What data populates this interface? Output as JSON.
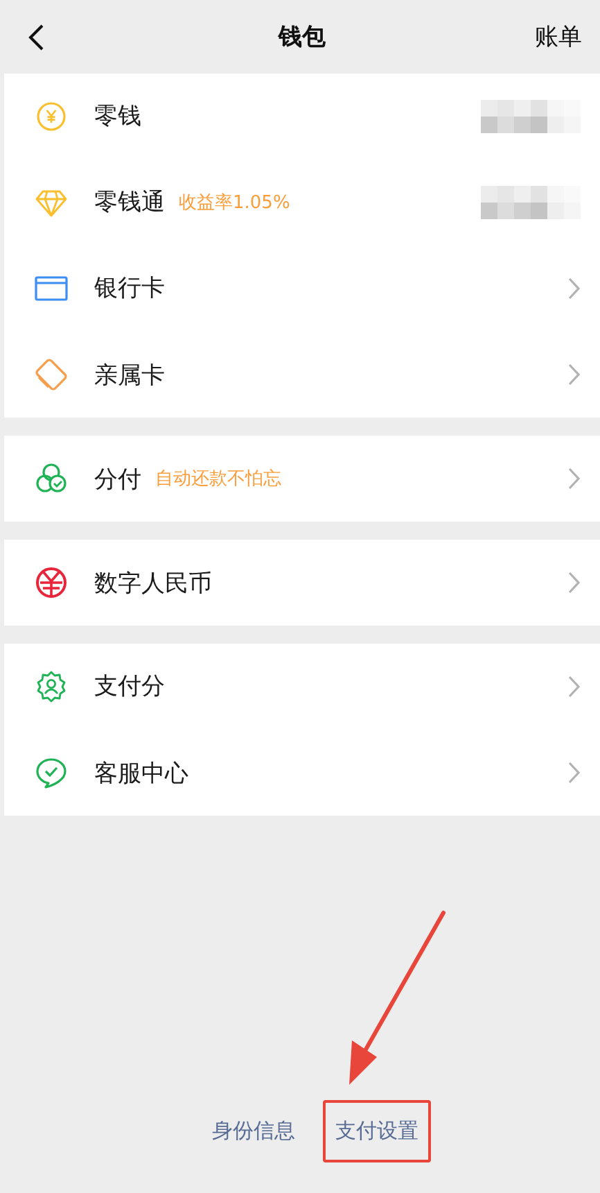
{
  "header": {
    "title": "钱包",
    "action": "账单"
  },
  "sections": [
    {
      "rows": [
        {
          "label": "零钱",
          "kind": "balance"
        },
        {
          "label": "零钱通",
          "tag": "收益率1.05%",
          "kind": "balance"
        },
        {
          "label": "银行卡",
          "kind": "link"
        },
        {
          "label": "亲属卡",
          "kind": "link"
        }
      ]
    },
    {
      "rows": [
        {
          "label": "分付",
          "tag": "自动还款不怕忘",
          "kind": "link"
        }
      ]
    },
    {
      "rows": [
        {
          "label": "数字人民币",
          "kind": "link"
        }
      ]
    },
    {
      "rows": [
        {
          "label": "支付分",
          "kind": "link"
        },
        {
          "label": "客服中心",
          "kind": "link"
        }
      ]
    }
  ],
  "footer_links": [
    {
      "label": "身份信息",
      "highlighted": false
    },
    {
      "label": "支付设置",
      "highlighted": true
    }
  ]
}
